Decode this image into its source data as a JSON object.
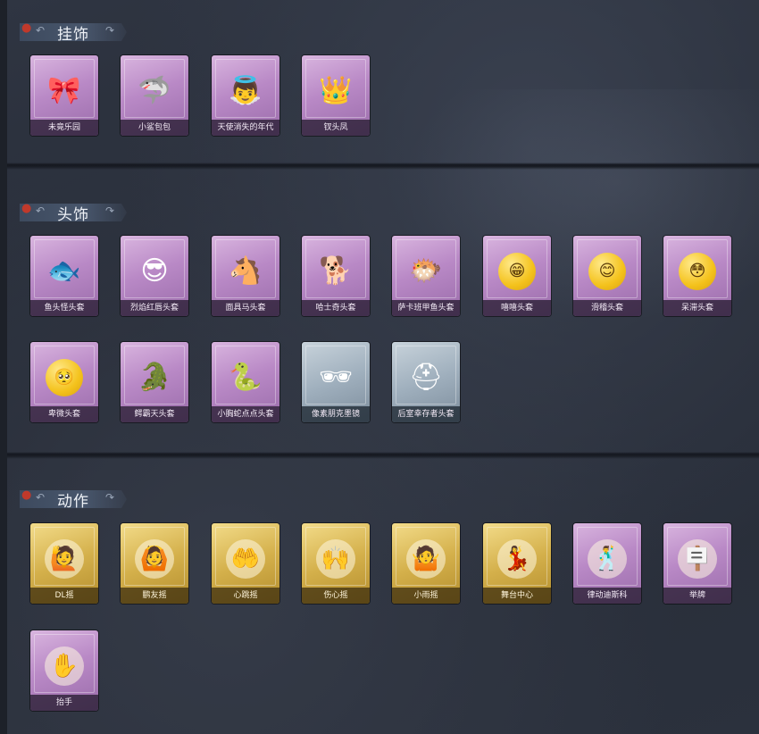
{
  "sections": [
    {
      "title": "挂饰",
      "items": [
        {
          "label": "未竟乐园",
          "icon": "🎀",
          "rarity": "purple"
        },
        {
          "label": "小鲨包包",
          "icon": "🦈",
          "rarity": "purple"
        },
        {
          "label": "天使消失的年代",
          "icon": "👼",
          "rarity": "purple"
        },
        {
          "label": "钗头凤",
          "icon": "👑",
          "rarity": "purple"
        }
      ]
    },
    {
      "title": "头饰",
      "items": [
        {
          "label": "鱼头怪头套",
          "icon": "🐟",
          "rarity": "purple"
        },
        {
          "label": "烈焰红唇头套",
          "icon": "😎",
          "rarity": "purple"
        },
        {
          "label": "面具马头套",
          "icon": "🐴",
          "rarity": "purple"
        },
        {
          "label": "哈士奇头套",
          "icon": "🐕",
          "rarity": "purple"
        },
        {
          "label": "萨卡班甲鱼头套",
          "icon": "🐡",
          "rarity": "purple"
        },
        {
          "label": "嘻嘻头套",
          "face": "😁",
          "rarity": "purple"
        },
        {
          "label": "滑稽头套",
          "face": "😊",
          "rarity": "purple"
        },
        {
          "label": "呆滞头套",
          "face": "😳",
          "rarity": "purple"
        },
        {
          "label": "卑微头套",
          "face": "🥺",
          "rarity": "purple"
        },
        {
          "label": "鳄霸天头套",
          "icon": "🐊",
          "rarity": "purple"
        },
        {
          "label": "小胸蛇点点头套",
          "icon": "🐍",
          "rarity": "purple"
        },
        {
          "label": "像素朋克墨镜",
          "icon": "🕶",
          "rarity": "grey"
        },
        {
          "label": "后室幸存者头套",
          "icon": "⛑",
          "rarity": "grey"
        }
      ]
    },
    {
      "title": "动作",
      "items": [
        {
          "label": "DL摇",
          "pose": "🙋",
          "rarity": "gold"
        },
        {
          "label": "鹏友摇",
          "pose": "🙆",
          "rarity": "gold"
        },
        {
          "label": "心跳摇",
          "pose": "🤲",
          "rarity": "gold"
        },
        {
          "label": "伤心摇",
          "pose": "🙌",
          "rarity": "gold"
        },
        {
          "label": "小雨摇",
          "pose": "🤷",
          "rarity": "gold"
        },
        {
          "label": "舞台中心",
          "pose": "💃",
          "rarity": "gold"
        },
        {
          "label": "律动迪斯科",
          "pose": "🕺",
          "rarity": "purple"
        },
        {
          "label": "举牌",
          "pose": "🪧",
          "rarity": "purple"
        },
        {
          "label": "抬手",
          "pose": "✋",
          "rarity": "purple"
        }
      ]
    }
  ]
}
